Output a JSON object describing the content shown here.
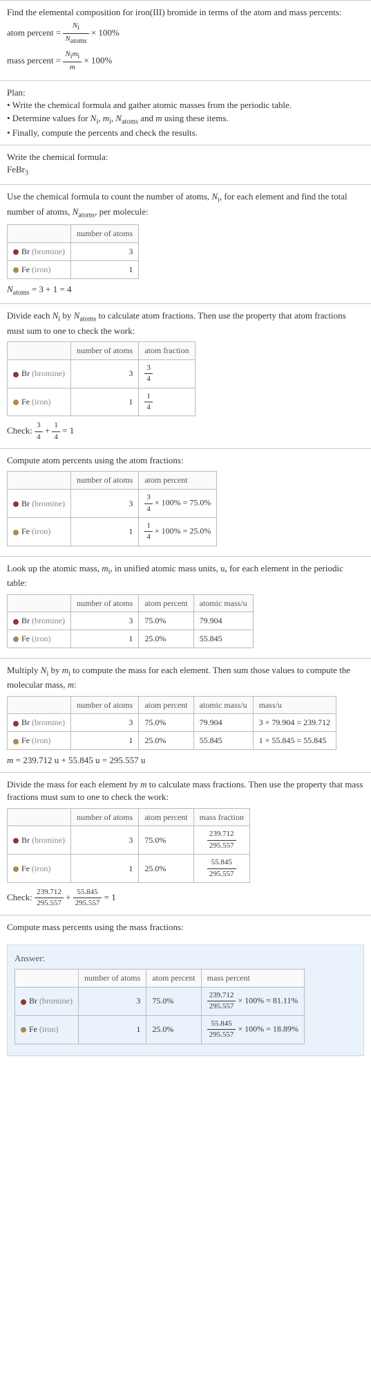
{
  "intro": {
    "question": "Find the elemental composition for iron(III) bromide in terms of the atom and mass percents:",
    "atom_pct_lhs": "atom percent =",
    "atom_pct_num": "N",
    "atom_pct_num_sub": "i",
    "atom_pct_den": "N",
    "atom_pct_den_sub": "atoms",
    "times100": "× 100%",
    "mass_pct_lhs": "mass percent =",
    "mass_pct_num_a": "N",
    "mass_pct_num_a_sub": "i",
    "mass_pct_num_b": "m",
    "mass_pct_num_b_sub": "i",
    "mass_pct_den": "m"
  },
  "plan": {
    "title": "Plan:",
    "b1": "• Write the chemical formula and gather atomic masses from the periodic table.",
    "b2_a": "• Determine values for ",
    "b2_b": " using these items.",
    "b3": "• Finally, compute the percents and check the results."
  },
  "formula": {
    "title": "Write the chemical formula:",
    "value": "FeBr",
    "sub": "3"
  },
  "count": {
    "intro_a": "Use the chemical formula to count the number of atoms, ",
    "intro_b": ", for each element and find the total number of atoms, ",
    "intro_c": ", per molecule:",
    "col_atoms": "number of atoms",
    "br_label": "Br",
    "br_name": "(bromine)",
    "br_n": "3",
    "fe_label": "Fe",
    "fe_name": "(iron)",
    "fe_n": "1",
    "total": " = 3 + 1 = 4"
  },
  "atomfrac": {
    "intro_a": "Divide each ",
    "intro_b": " by ",
    "intro_c": " to calculate atom fractions. Then use the property that atom fractions must sum to one to check the work:",
    "col_frac": "atom fraction",
    "br_frac_num": "3",
    "br_frac_den": "4",
    "fe_frac_num": "1",
    "fe_frac_den": "4",
    "check_a": "Check: ",
    "check_b": " + ",
    "check_c": " = 1"
  },
  "atompct": {
    "intro": "Compute atom percents using the atom fractions:",
    "col_pct": "atom percent",
    "br_eq": " × 100% = 75.0%",
    "fe_eq": " × 100% = 25.0%"
  },
  "massu": {
    "intro_a": "Look up the atomic mass, ",
    "intro_b": ", in unified atomic mass units, u, for each element in the periodic table:",
    "col_massu": "atomic mass/u",
    "br_pct": "75.0%",
    "br_mass": "79.904",
    "fe_pct": "25.0%",
    "fe_mass": "55.845"
  },
  "molmass": {
    "intro_a": "Multiply ",
    "intro_b": " by ",
    "intro_c": " to compute the mass for each element. Then sum those values to compute the molecular mass, ",
    "intro_d": ":",
    "col_mass": "mass/u",
    "br_calc": "3 × 79.904 = 239.712",
    "fe_calc": "1 × 55.845 = 55.845",
    "total_a": "m",
    "total_b": " = 239.712 u + 55.845 u = 295.557 u"
  },
  "massfrac": {
    "intro_a": "Divide the mass for each element by ",
    "intro_b": " to calculate mass fractions. Then use the property that mass fractions must sum to one to check the work:",
    "col_frac": "mass fraction",
    "br_num": "239.712",
    "br_den": "295.557",
    "fe_num": "55.845",
    "fe_den": "295.557",
    "check_a": "Check: ",
    "check_b": " + ",
    "check_c": " = 1"
  },
  "masspct": {
    "intro": "Compute mass percents using the mass fractions:"
  },
  "answer": {
    "label": "Answer:",
    "col_masspct": "mass percent",
    "br_eq": " × 100% = 81.11%",
    "fe_eq": " × 100% = 18.89%"
  },
  "chart_data": [
    {
      "type": "table",
      "title": "number of atoms",
      "rows": [
        [
          "Br (bromine)",
          3
        ],
        [
          "Fe (iron)",
          1
        ]
      ]
    },
    {
      "type": "table",
      "title": "atom fraction",
      "rows": [
        [
          "Br (bromine)",
          3,
          "3/4"
        ],
        [
          "Fe (iron)",
          1,
          "1/4"
        ]
      ]
    },
    {
      "type": "table",
      "title": "atom percent",
      "rows": [
        [
          "Br (bromine)",
          3,
          "75.0%"
        ],
        [
          "Fe (iron)",
          1,
          "25.0%"
        ]
      ]
    },
    {
      "type": "table",
      "title": "atomic mass/u",
      "rows": [
        [
          "Br (bromine)",
          3,
          "75.0%",
          79.904
        ],
        [
          "Fe (iron)",
          1,
          "25.0%",
          55.845
        ]
      ]
    },
    {
      "type": "table",
      "title": "mass/u",
      "rows": [
        [
          "Br (bromine)",
          3,
          "75.0%",
          79.904,
          "3 × 79.904 = 239.712"
        ],
        [
          "Fe (iron)",
          1,
          "25.0%",
          55.845,
          "1 × 55.845 = 55.845"
        ]
      ]
    },
    {
      "type": "table",
      "title": "mass fraction",
      "rows": [
        [
          "Br (bromine)",
          3,
          "75.0%",
          "239.712/295.557"
        ],
        [
          "Fe (iron)",
          1,
          "25.0%",
          "55.845/295.557"
        ]
      ]
    },
    {
      "type": "table",
      "title": "mass percent",
      "rows": [
        [
          "Br (bromine)",
          3,
          "75.0%",
          "81.11%"
        ],
        [
          "Fe (iron)",
          1,
          "25.0%",
          "18.89%"
        ]
      ]
    }
  ]
}
